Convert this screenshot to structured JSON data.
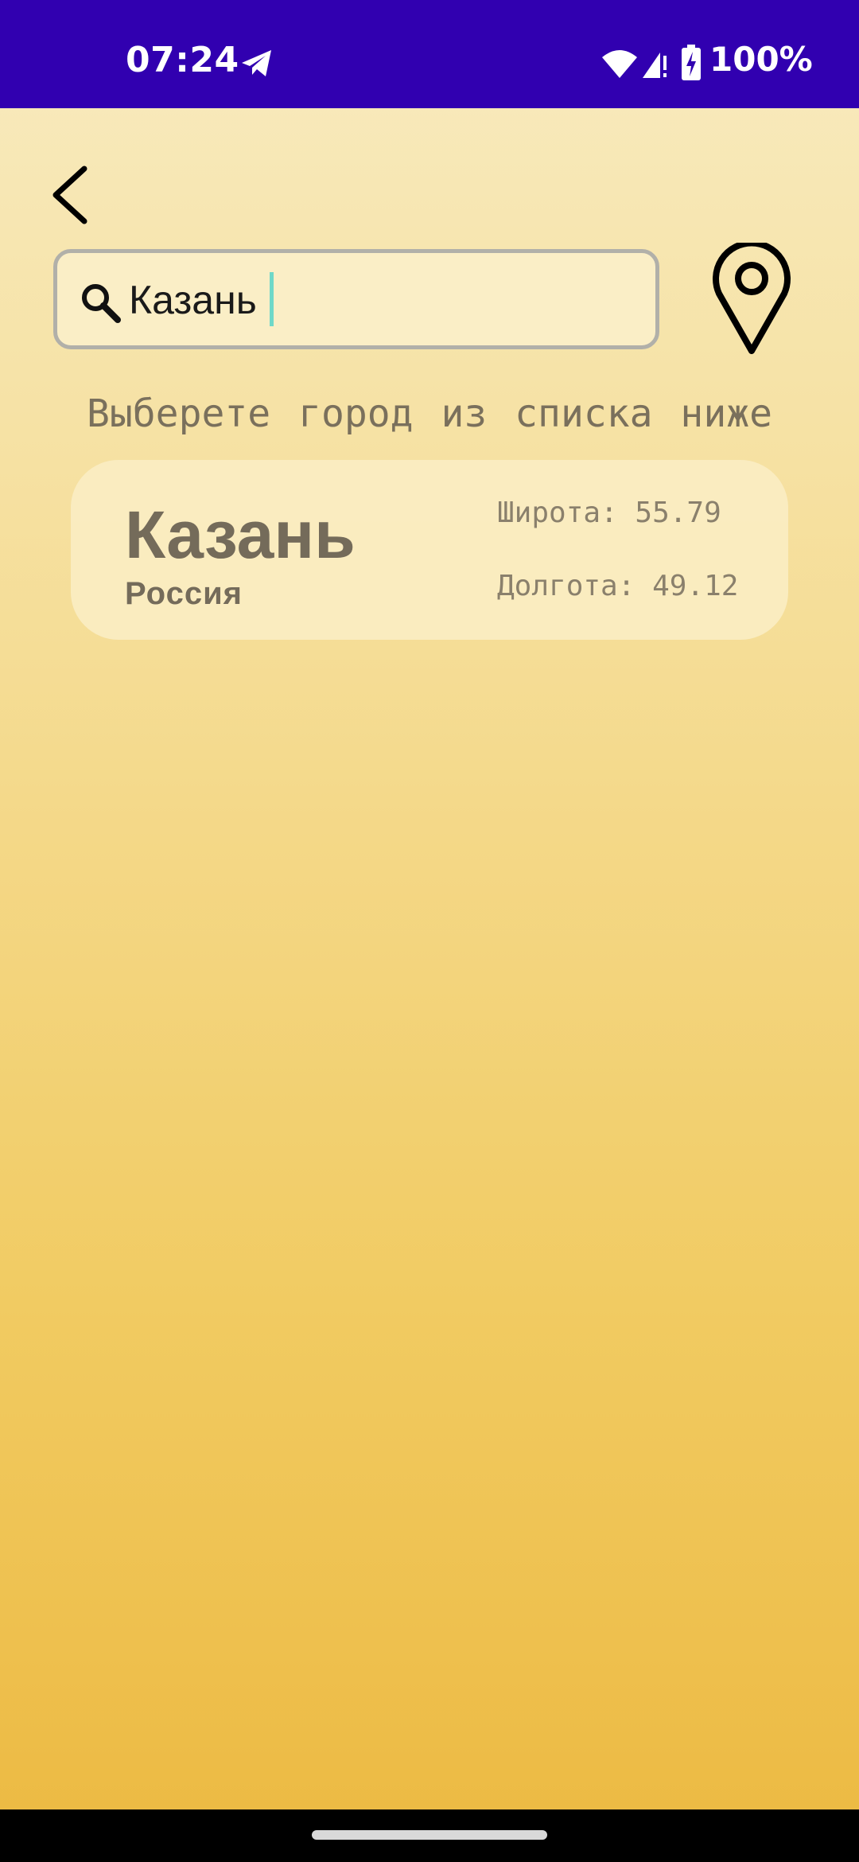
{
  "status_bar": {
    "time": "07:24",
    "battery": "100%",
    "background_color": "#3100b0",
    "icons": [
      "telegram-icon",
      "wifi-icon",
      "signal-icon",
      "battery-charging-icon"
    ]
  },
  "search": {
    "value": "Казань",
    "border_color": "#b1b0a9",
    "cursor_color": "#6fd8c8"
  },
  "hint": "Выберете город из списка ниже",
  "results": [
    {
      "city": "Казань",
      "country": "Россия",
      "latitude_label": "Широта: 55.79",
      "longitude_label": "Долгота: 49.12"
    }
  ],
  "colors": {
    "text_muted": "#746b5a",
    "gradient_top": "#f8ebc0",
    "gradient_bottom": "#ecb941"
  }
}
